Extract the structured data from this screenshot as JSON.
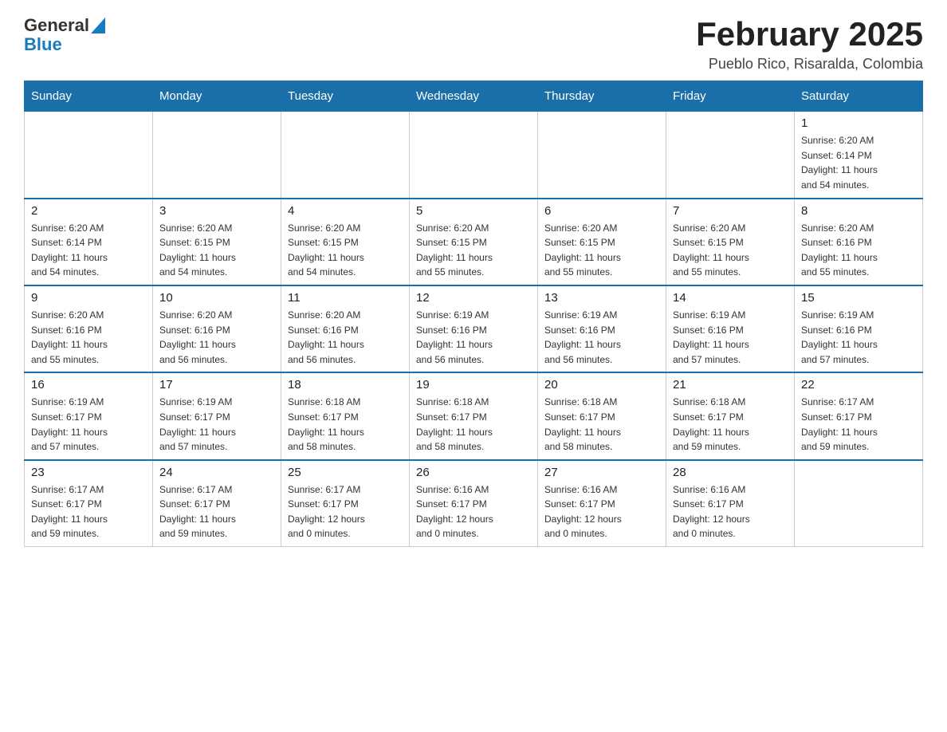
{
  "header": {
    "logo_general": "General",
    "logo_blue": "Blue",
    "month_title": "February 2025",
    "subtitle": "Pueblo Rico, Risaralda, Colombia"
  },
  "weekdays": [
    "Sunday",
    "Monday",
    "Tuesday",
    "Wednesday",
    "Thursday",
    "Friday",
    "Saturday"
  ],
  "weeks": [
    {
      "days": [
        {
          "num": "",
          "info": ""
        },
        {
          "num": "",
          "info": ""
        },
        {
          "num": "",
          "info": ""
        },
        {
          "num": "",
          "info": ""
        },
        {
          "num": "",
          "info": ""
        },
        {
          "num": "",
          "info": ""
        },
        {
          "num": "1",
          "info": "Sunrise: 6:20 AM\nSunset: 6:14 PM\nDaylight: 11 hours\nand 54 minutes."
        }
      ]
    },
    {
      "days": [
        {
          "num": "2",
          "info": "Sunrise: 6:20 AM\nSunset: 6:14 PM\nDaylight: 11 hours\nand 54 minutes."
        },
        {
          "num": "3",
          "info": "Sunrise: 6:20 AM\nSunset: 6:15 PM\nDaylight: 11 hours\nand 54 minutes."
        },
        {
          "num": "4",
          "info": "Sunrise: 6:20 AM\nSunset: 6:15 PM\nDaylight: 11 hours\nand 54 minutes."
        },
        {
          "num": "5",
          "info": "Sunrise: 6:20 AM\nSunset: 6:15 PM\nDaylight: 11 hours\nand 55 minutes."
        },
        {
          "num": "6",
          "info": "Sunrise: 6:20 AM\nSunset: 6:15 PM\nDaylight: 11 hours\nand 55 minutes."
        },
        {
          "num": "7",
          "info": "Sunrise: 6:20 AM\nSunset: 6:15 PM\nDaylight: 11 hours\nand 55 minutes."
        },
        {
          "num": "8",
          "info": "Sunrise: 6:20 AM\nSunset: 6:16 PM\nDaylight: 11 hours\nand 55 minutes."
        }
      ]
    },
    {
      "days": [
        {
          "num": "9",
          "info": "Sunrise: 6:20 AM\nSunset: 6:16 PM\nDaylight: 11 hours\nand 55 minutes."
        },
        {
          "num": "10",
          "info": "Sunrise: 6:20 AM\nSunset: 6:16 PM\nDaylight: 11 hours\nand 56 minutes."
        },
        {
          "num": "11",
          "info": "Sunrise: 6:20 AM\nSunset: 6:16 PM\nDaylight: 11 hours\nand 56 minutes."
        },
        {
          "num": "12",
          "info": "Sunrise: 6:19 AM\nSunset: 6:16 PM\nDaylight: 11 hours\nand 56 minutes."
        },
        {
          "num": "13",
          "info": "Sunrise: 6:19 AM\nSunset: 6:16 PM\nDaylight: 11 hours\nand 56 minutes."
        },
        {
          "num": "14",
          "info": "Sunrise: 6:19 AM\nSunset: 6:16 PM\nDaylight: 11 hours\nand 57 minutes."
        },
        {
          "num": "15",
          "info": "Sunrise: 6:19 AM\nSunset: 6:16 PM\nDaylight: 11 hours\nand 57 minutes."
        }
      ]
    },
    {
      "days": [
        {
          "num": "16",
          "info": "Sunrise: 6:19 AM\nSunset: 6:17 PM\nDaylight: 11 hours\nand 57 minutes."
        },
        {
          "num": "17",
          "info": "Sunrise: 6:19 AM\nSunset: 6:17 PM\nDaylight: 11 hours\nand 57 minutes."
        },
        {
          "num": "18",
          "info": "Sunrise: 6:18 AM\nSunset: 6:17 PM\nDaylight: 11 hours\nand 58 minutes."
        },
        {
          "num": "19",
          "info": "Sunrise: 6:18 AM\nSunset: 6:17 PM\nDaylight: 11 hours\nand 58 minutes."
        },
        {
          "num": "20",
          "info": "Sunrise: 6:18 AM\nSunset: 6:17 PM\nDaylight: 11 hours\nand 58 minutes."
        },
        {
          "num": "21",
          "info": "Sunrise: 6:18 AM\nSunset: 6:17 PM\nDaylight: 11 hours\nand 59 minutes."
        },
        {
          "num": "22",
          "info": "Sunrise: 6:17 AM\nSunset: 6:17 PM\nDaylight: 11 hours\nand 59 minutes."
        }
      ]
    },
    {
      "days": [
        {
          "num": "23",
          "info": "Sunrise: 6:17 AM\nSunset: 6:17 PM\nDaylight: 11 hours\nand 59 minutes."
        },
        {
          "num": "24",
          "info": "Sunrise: 6:17 AM\nSunset: 6:17 PM\nDaylight: 11 hours\nand 59 minutes."
        },
        {
          "num": "25",
          "info": "Sunrise: 6:17 AM\nSunset: 6:17 PM\nDaylight: 12 hours\nand 0 minutes."
        },
        {
          "num": "26",
          "info": "Sunrise: 6:16 AM\nSunset: 6:17 PM\nDaylight: 12 hours\nand 0 minutes."
        },
        {
          "num": "27",
          "info": "Sunrise: 6:16 AM\nSunset: 6:17 PM\nDaylight: 12 hours\nand 0 minutes."
        },
        {
          "num": "28",
          "info": "Sunrise: 6:16 AM\nSunset: 6:17 PM\nDaylight: 12 hours\nand 0 minutes."
        },
        {
          "num": "",
          "info": ""
        }
      ]
    }
  ]
}
